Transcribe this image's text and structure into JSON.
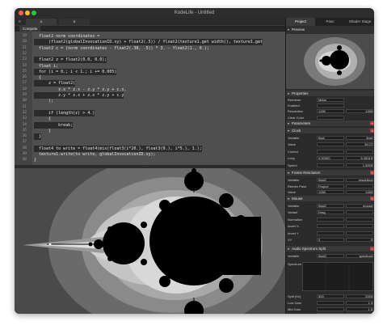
{
  "window": {
    "title": "KodeLife - Untitled"
  },
  "toolbar": {
    "tab_a": "A",
    "tab_b": "B"
  },
  "editor": {
    "tab": "Compute",
    "lines": [
      {
        "n": "19",
        "t": "  float2 norm coordinates =",
        "hl": false
      },
      {
        "n": "20",
        "t": "      (float2(globalInvocationID.xy) + float2(.5)) / float2(texture1.get width(), texture1.get",
        "hl": true
      },
      {
        "n": "21",
        "t": "  float2 c = (norm coordinates - float2(.38, .5)) * 3. - float2(1., 0.);",
        "hl": false
      },
      {
        "n": "22",
        "t": "",
        "hl": false
      },
      {
        "n": "23",
        "t": "  float2 z = float2(0.0, 0.0);",
        "hl": true
      },
      {
        "n": "24",
        "t": "  float i;",
        "hl": false
      },
      {
        "n": "25",
        "t": "  for (i = 0.; i < 1.; i += 0.005)",
        "hl": true
      },
      {
        "n": "26",
        "t": "  {",
        "hl": false
      },
      {
        "n": "27",
        "t": "      z = float2(",
        "hl": true
      },
      {
        "n": "28",
        "t": "          z.x * z.x - z.y * z.y + c.x,",
        "hl": false
      },
      {
        "n": "29",
        "t": "          z.y * z.x + z.x * z.y + c.y",
        "hl": true
      },
      {
        "n": "30",
        "t": "      );",
        "hl": false
      },
      {
        "n": "31",
        "t": "",
        "hl": false
      },
      {
        "n": "32",
        "t": "      if (length(z) > 4.)",
        "hl": true
      },
      {
        "n": "33",
        "t": "      {",
        "hl": false
      },
      {
        "n": "34",
        "t": "          break;",
        "hl": true
      },
      {
        "n": "35",
        "t": "      }",
        "hl": false
      },
      {
        "n": "36",
        "t": "  }",
        "hl": true
      },
      {
        "n": "37",
        "t": "",
        "hl": false
      },
      {
        "n": "38",
        "t": "  float4 to write = float4(mix(float3(i*20.), float3(0.), i*5.), 1.);",
        "hl": true
      },
      {
        "n": "39",
        "t": "  texture1.write(to write, globalInvocationID.xy);",
        "hl": false
      },
      {
        "n": "40",
        "t": "}",
        "hl": false
      }
    ]
  },
  "panel": {
    "tabs": [
      "Project",
      "Pass",
      "Shader Stage"
    ],
    "preview_title": "Preview",
    "properties_title": "Properties",
    "properties": [
      {
        "k": "Renderer",
        "v": "Metal"
      },
      {
        "k": "Enabled",
        "v": ""
      },
      {
        "k": "Resolution",
        "v": "1280",
        "v2": "1280"
      },
      {
        "k": "Clear Color",
        "v": ""
      }
    ],
    "parameters_title": "Parameters",
    "clock_title": "Clock",
    "clock_rows": [
      {
        "k": "Variable",
        "v": "float",
        "v2": "time"
      },
      {
        "k": "Value",
        "v": "",
        "v2": "39.27"
      },
      {
        "k": "Control",
        "v": "",
        "v2": ""
      },
      {
        "k": "Loop",
        "v": "0.00000",
        "v2": "6.28319"
      },
      {
        "k": "Speed",
        "v": "",
        "v2": "1.0000"
      }
    ],
    "frame_title": "Frame Resolution",
    "frame_rows": [
      {
        "k": "Variable",
        "v": "float2",
        "v2": "resolution"
      },
      {
        "k": "Render Pass",
        "v": "Project",
        "v2": ""
      },
      {
        "k": "Value",
        "v": "1280",
        "v2": "1280"
      }
    ],
    "mouse_title": "Mouse",
    "mouse_rows": [
      {
        "k": "Variable",
        "v": "float2",
        "v2": "mouse"
      },
      {
        "k": "Variant",
        "v": "Drag",
        "v2": ""
      },
      {
        "k": "Normalize",
        "v": "",
        "v2": ""
      },
      {
        "k": "Invert X",
        "v": "",
        "v2": ""
      },
      {
        "k": "Invert Y",
        "v": "",
        "v2": ""
      },
      {
        "k": "XY",
        "v": "0",
        "v2": "0"
      }
    ],
    "audio_title": "Audio Spectrum Split",
    "audio_rows": [
      {
        "k": "Variable",
        "v": "float3",
        "v2": "spectrum"
      },
      {
        "k": "Spectrum",
        "v": "",
        "v2": ""
      }
    ],
    "audio_bottom": [
      {
        "k": "Split (Hz)",
        "v": "500",
        "v2": "2000"
      },
      {
        "k": "Low Gain",
        "v": "",
        "v2": "1.0"
      },
      {
        "k": "Mid Gain",
        "v": "",
        "v2": "1.0"
      },
      {
        "k": "High Gain",
        "v": "",
        "v2": "1.0"
      }
    ]
  },
  "colors": {
    "accent": "#b23a3a",
    "editor_bg": "#4f4f4f",
    "selected_line": "#2b2b2b"
  }
}
